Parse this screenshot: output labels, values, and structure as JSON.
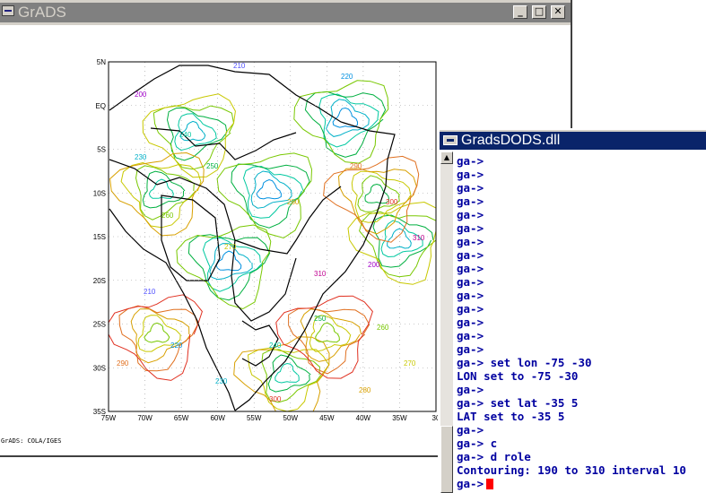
{
  "grads_window": {
    "title": "GrADS",
    "buttons": {
      "minimize": "_",
      "maximize": "□",
      "close": "✕"
    },
    "system_icon": "window-icon",
    "credit": "GrADS: COLA/IGES",
    "y_ticks": [
      "5N",
      "EQ",
      "5S",
      "10S",
      "15S",
      "20S",
      "25S",
      "30S",
      "35S"
    ],
    "x_ticks": [
      "75W",
      "70W",
      "65W",
      "60W",
      "55W",
      "50W",
      "45W",
      "40W",
      "35W",
      "30"
    ],
    "contour_labels": [
      "200",
      "210",
      "220",
      "230",
      "240",
      "250",
      "260",
      "270",
      "280",
      "290",
      "300",
      "310"
    ]
  },
  "dods_window": {
    "title": "GradsDODS.dll",
    "system_icon": "console-window-icon",
    "lines": [
      "ga->",
      "ga->",
      "ga->",
      "ga->",
      "ga->",
      "ga->",
      "ga->",
      "ga->",
      "ga->",
      "ga->",
      "ga->",
      "ga->",
      "ga->",
      "ga->",
      "ga->",
      "ga-> set lon -75 -30",
      "LON set to -75 -30",
      "ga->",
      "ga-> set lat -35 5",
      "LAT set to -35 5",
      "ga->",
      "ga-> c",
      "ga-> d role",
      "Contouring: 190 to 310 interval 10"
    ],
    "prompt": "ga->"
  },
  "colors": {
    "title_active": "#0a246a",
    "title_inactive": "#808080",
    "console_text": "#0000a0",
    "cursor": "#ff0000"
  }
}
